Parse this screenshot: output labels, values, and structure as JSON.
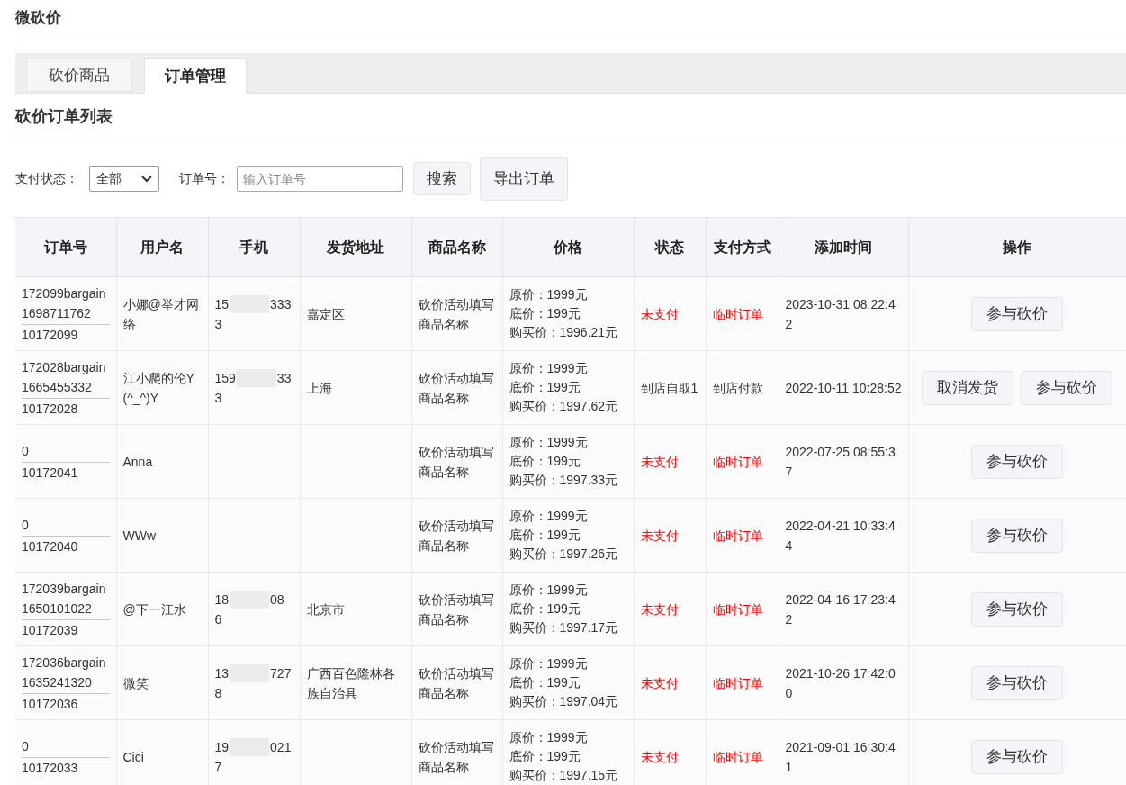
{
  "page_title": "微砍价",
  "tabs": [
    {
      "label": "砍价商品",
      "selected": false
    },
    {
      "label": "订单管理",
      "selected": true
    }
  ],
  "section_title": "砍价订单列表",
  "filters": {
    "status_label": "支付状态：",
    "status_value": "全部",
    "order_label": "订单号：",
    "order_placeholder": "输入订单号",
    "search_button": "搜索",
    "export_button": "导出订单"
  },
  "table": {
    "columns": [
      "订单号",
      "用户名",
      "手机",
      "发货地址",
      "商品名称",
      "价格",
      "状态",
      "支付方式",
      "添加时间",
      "操作"
    ],
    "rows": [
      {
        "order_no": "172099bargain1698711762",
        "order_id": "10172099",
        "user": "小娜@举才网络",
        "phone": {
          "head": "15",
          "tail": "333",
          "line_2": "3"
        },
        "address": "嘉定区",
        "product": "砍价活动填写商品名称",
        "prices": [
          "原价：1999元",
          "底价：199元",
          "购买价：1996.21元"
        ],
        "status": "未支付",
        "status_alert": true,
        "payment": "临时订单",
        "payment_alert": true,
        "time": "2023-10-31 08:22:42",
        "actions": [
          "参与砍价"
        ]
      },
      {
        "order_no": "172028bargain1665455332",
        "order_id": "10172028",
        "user": "江小爬的伦Y(^_^)Y",
        "phone": {
          "head": "159",
          "tail": "33",
          "line_2": "3"
        },
        "address": "上海",
        "product": "砍价活动填写商品名称",
        "prices": [
          "原价：1999元",
          "底价：199元",
          "购买价：1997.62元"
        ],
        "status": "到店自取1",
        "status_alert": false,
        "payment": "到店付款",
        "payment_alert": false,
        "time": "2022-10-11 10:28:52",
        "actions": [
          "取消发货",
          "参与砍价"
        ]
      },
      {
        "order_no": "0",
        "order_id": "10172041",
        "user": "Anna",
        "product": "砍价活动填写商品名称",
        "prices": [
          "原价：1999元",
          "底价：199元",
          "购买价：1997.33元"
        ],
        "status": "未支付",
        "status_alert": true,
        "payment": "临时订单",
        "payment_alert": true,
        "time": "2022-07-25 08:55:37",
        "actions": [
          "参与砍价"
        ]
      },
      {
        "order_no": "0",
        "order_id": "10172040",
        "user": "WWw",
        "product": "砍价活动填写商品名称",
        "prices": [
          "原价：1999元",
          "底价：199元",
          "购买价：1997.26元"
        ],
        "status": "未支付",
        "status_alert": true,
        "payment": "临时订单",
        "payment_alert": true,
        "time": "2022-04-21 10:33:44",
        "actions": [
          "参与砍价"
        ]
      },
      {
        "order_no": "172039bargain1650101022",
        "order_id": "10172039",
        "user": "@下一江水",
        "phone": {
          "head": "18",
          "tail": "08",
          "line_2": "6"
        },
        "address": "北京市",
        "product": "砍价活动填写商品名称",
        "prices": [
          "原价：1999元",
          "底价：199元",
          "购买价：1997.17元"
        ],
        "status": "未支付",
        "status_alert": true,
        "payment": "临时订单",
        "payment_alert": true,
        "time": "2022-04-16 17:23:42",
        "actions": [
          "参与砍价"
        ]
      },
      {
        "order_no": "172036bargain1635241320",
        "order_id": "10172036",
        "user": "微笑",
        "phone": {
          "head": "13",
          "tail": "727",
          "line_2": "8"
        },
        "address": "广西百色隆林各族自治具",
        "product": "砍价活动填写商品名称",
        "prices": [
          "原价：1999元",
          "底价：199元",
          "购买价：1997.04元"
        ],
        "status": "未支付",
        "status_alert": true,
        "payment": "临时订单",
        "payment_alert": true,
        "time": "2021-10-26 17:42:00",
        "actions": [
          "参与砍价"
        ]
      },
      {
        "order_no": "0",
        "order_id": "10172033",
        "user": "Cici",
        "phone": {
          "head": "19",
          "tail": "021",
          "line_2": "7"
        },
        "product": "砍价活动填写商品名称",
        "prices": [
          "原价：1999元",
          "底价：199元",
          "购买价：1997.15元"
        ],
        "status": "未支付",
        "status_alert": true,
        "payment": "临时订单",
        "payment_alert": true,
        "time": "2021-09-01 16:30:41",
        "actions": [
          "参与砍价"
        ]
      }
    ]
  }
}
